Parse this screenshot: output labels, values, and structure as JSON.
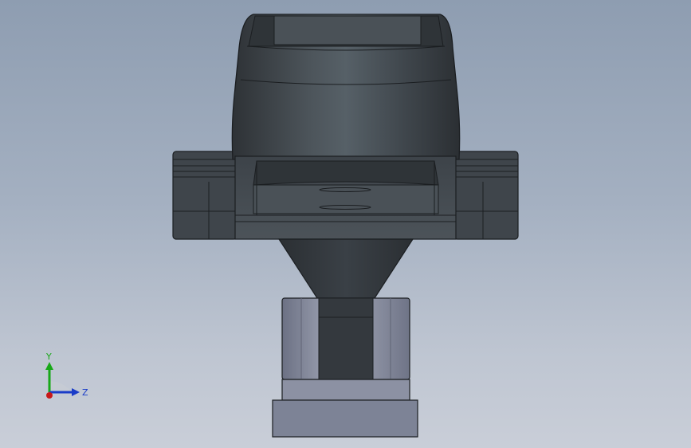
{
  "app": {
    "view_name": ""
  },
  "model": {
    "name": "",
    "colors": {
      "housing_dark": "#3a3f45",
      "housing_mid": "#4a5157",
      "housing_light": "#5d656c",
      "edge": "#1b1e21",
      "bracket": "#7c8193",
      "bracket_light": "#9aa0b0",
      "base_plate": "#80879a"
    }
  },
  "triad": {
    "y_label": "Y",
    "z_label": "Z",
    "y_color": "#18a818",
    "z_color": "#1a3cc8",
    "x_color": "#c81818"
  }
}
